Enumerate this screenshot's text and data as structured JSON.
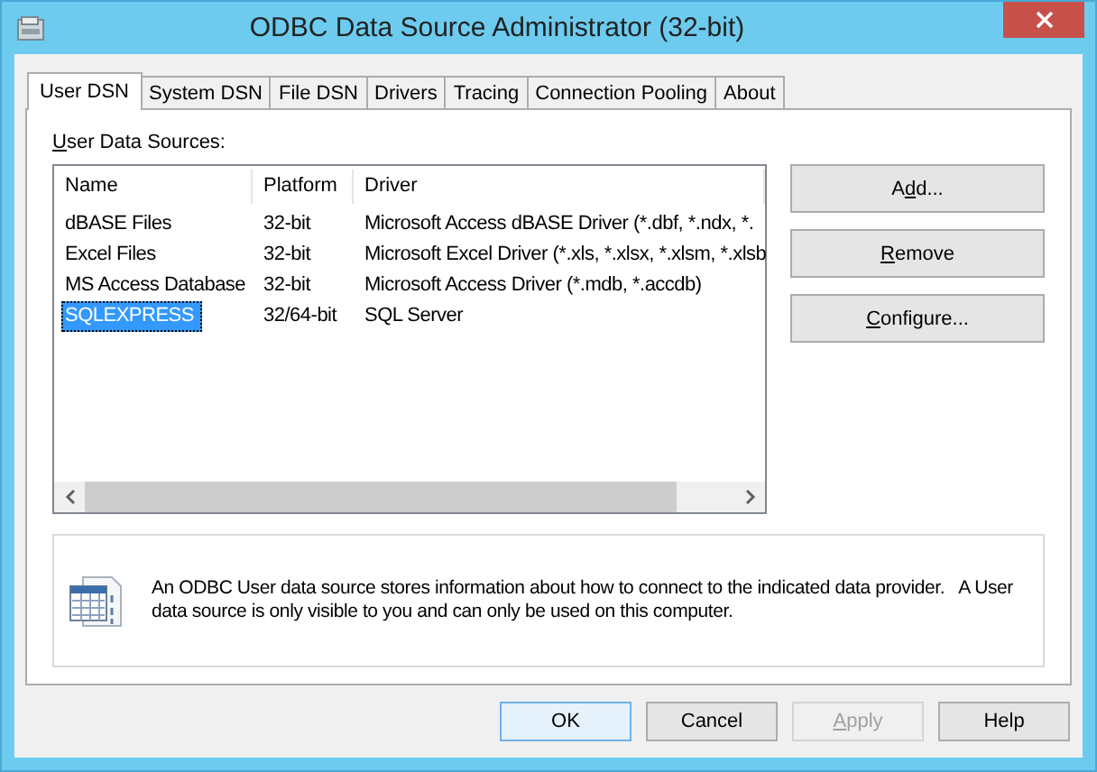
{
  "window": {
    "title": "ODBC Data Source Administrator (32-bit)"
  },
  "tabs": [
    {
      "label": "User DSN",
      "selected": true
    },
    {
      "label": "System DSN",
      "selected": false
    },
    {
      "label": "File DSN",
      "selected": false
    },
    {
      "label": "Drivers",
      "selected": false
    },
    {
      "label": "Tracing",
      "selected": false
    },
    {
      "label": "Connection Pooling",
      "selected": false
    },
    {
      "label": "About",
      "selected": false
    }
  ],
  "list_label": {
    "access_key": "U",
    "after": "ser Data Sources:"
  },
  "table": {
    "columns": [
      "Name",
      "Platform",
      "Driver"
    ],
    "rows": [
      {
        "cells": [
          "dBASE Files",
          "32-bit",
          "Microsoft Access dBASE Driver (*.dbf, *.ndx, *."
        ],
        "selected": false
      },
      {
        "cells": [
          "Excel Files",
          "32-bit",
          "Microsoft Excel Driver (*.xls, *.xlsx, *.xlsm, *.xlsb"
        ],
        "selected": false
      },
      {
        "cells": [
          "MS Access Database",
          "32-bit",
          "Microsoft Access Driver (*.mdb, *.accdb)"
        ],
        "selected": false
      },
      {
        "cells": [
          "SQLEXPRESS",
          "32/64-bit",
          "SQL Server"
        ],
        "selected": true
      }
    ]
  },
  "side_buttons": [
    {
      "before": "A",
      "access_key": "d",
      "after": "d...",
      "disabled": false
    },
    {
      "access_key": "R",
      "after": "emove",
      "disabled": false
    },
    {
      "access_key": "C",
      "after": "onfigure...",
      "disabled": false
    }
  ],
  "info": {
    "text": "An ODBC User data source stores information about how to connect to the indicated data provider.   A User data source is only visible to you and can only be used on this computer."
  },
  "dialog_buttons": [
    {
      "label": "OK",
      "default": true,
      "disabled": false
    },
    {
      "label": "Cancel",
      "default": false,
      "disabled": false
    },
    {
      "access_key": "A",
      "after": "pply",
      "default": false,
      "disabled": true
    },
    {
      "label": "Help",
      "default": false,
      "disabled": false
    }
  ]
}
